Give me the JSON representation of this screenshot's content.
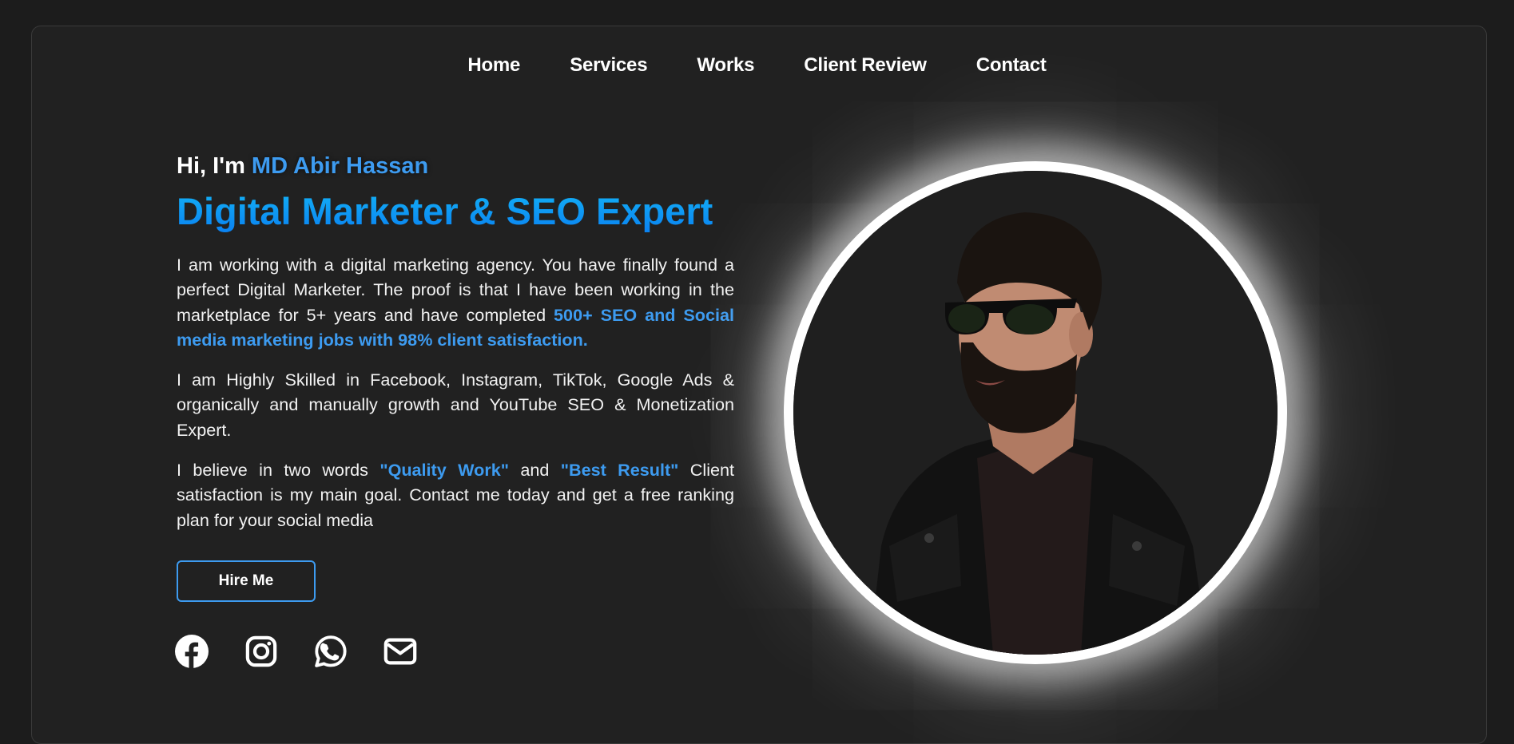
{
  "nav": {
    "items": [
      {
        "label": "Home"
      },
      {
        "label": "Services"
      },
      {
        "label": "Works"
      },
      {
        "label": "Client Review"
      },
      {
        "label": "Contact"
      }
    ]
  },
  "hero": {
    "greeting_prefix": "Hi, I'm ",
    "name": "MD Abir Hassan",
    "headline": "Digital Marketer & SEO Expert",
    "paragraph1": {
      "text": "I am working with a digital marketing agency. You have finally found a perfect Digital Marketer. The proof is that I have been working in the marketplace for 5+ years and have completed ",
      "highlight": "500+ SEO and Social media marketing jobs with 98% client satisfaction."
    },
    "paragraph2": {
      "text": "I am Highly Skilled in Facebook, Instagram, TikTok, Google Ads & organically and manually growth and YouTube SEO & Monetization Expert."
    },
    "paragraph3": {
      "part1": "I believe in two words ",
      "highlight1": "\"Quality Work\"",
      "part2": " and ",
      "highlight2": "\"Best Result\"",
      "part3": " Client satisfaction is my main goal. Contact me today and get a free ranking plan for your social media"
    },
    "hire_button": "Hire Me"
  },
  "socials": [
    {
      "icon": "facebook-icon"
    },
    {
      "icon": "instagram-icon"
    },
    {
      "icon": "whatsapp-icon"
    },
    {
      "icon": "email-icon"
    }
  ],
  "colors": {
    "accent": "#3d9bf0",
    "headline_gradient_top": "#13b3f6",
    "headline_gradient_bottom": "#0a7ff1",
    "background": "#212121",
    "text": "#ffffff"
  }
}
